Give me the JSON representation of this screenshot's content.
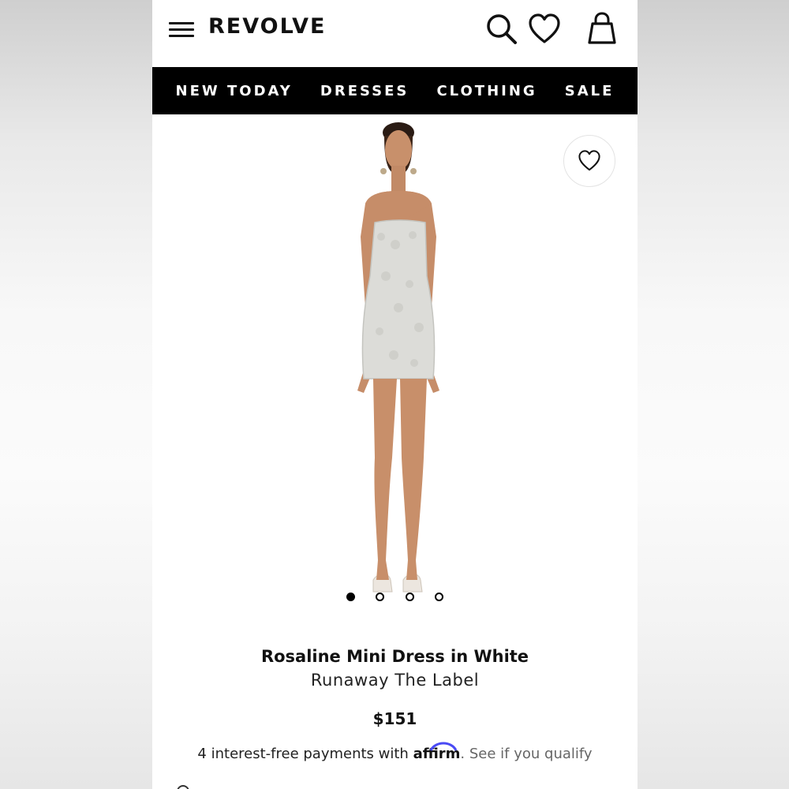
{
  "header": {
    "logo": "REVOLVE",
    "icons": [
      "menu-icon",
      "search-icon",
      "heart-icon",
      "bag-icon"
    ]
  },
  "nav": {
    "items": [
      "NEW TODAY",
      "DRESSES",
      "CLOTHING",
      "SALE"
    ]
  },
  "gallery": {
    "favorite_icon": "heart-outline-icon",
    "image_count": 4,
    "active_index": 0
  },
  "product": {
    "name": "Rosaline Mini Dress in White",
    "brand": "Runaway The Label",
    "price": "$151",
    "payments_prefix": "4 interest-free payments with ",
    "payments_provider": "affirm",
    "payments_link": ". See if you qualify"
  },
  "colors": {
    "nav_background": "#000000",
    "nav_text": "#ffffff",
    "text_primary": "#111111",
    "link_muted": "#666666",
    "affirm_accent": "#4a4af4"
  }
}
